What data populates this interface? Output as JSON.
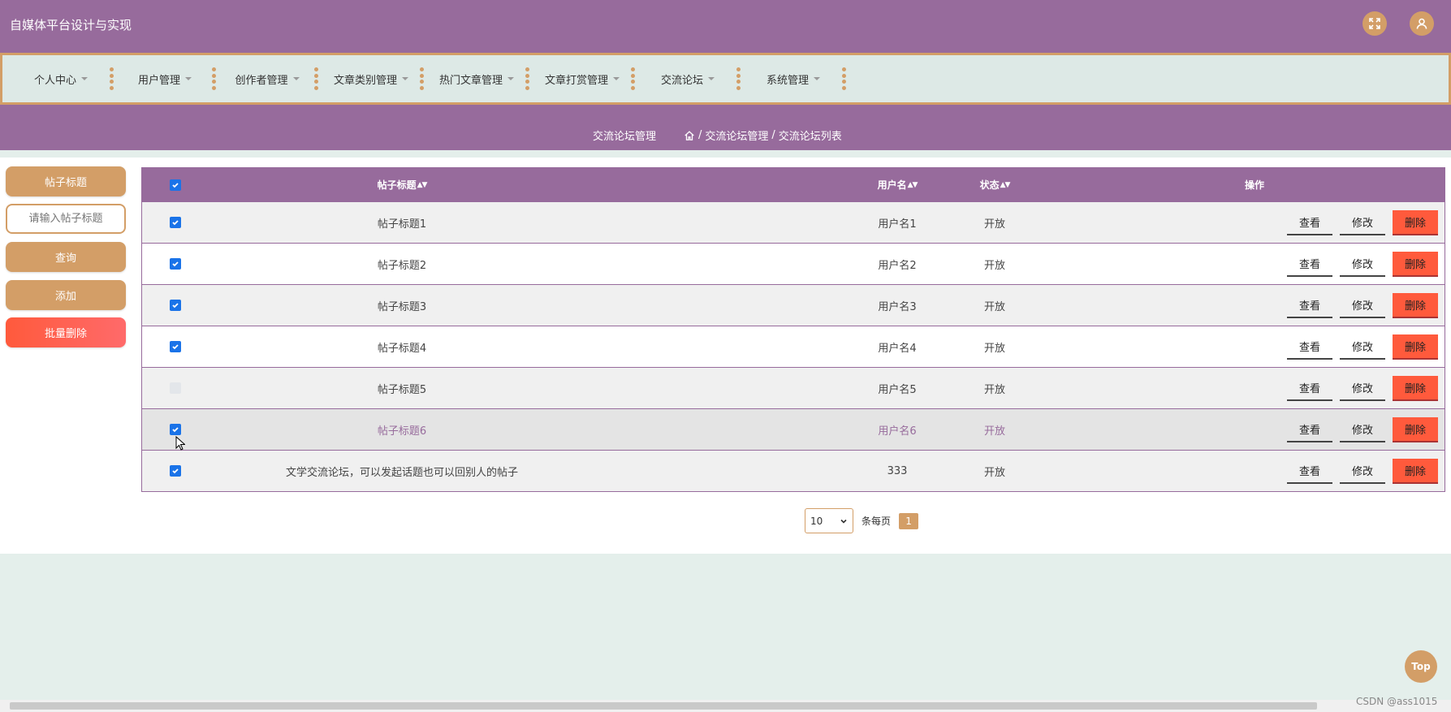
{
  "header": {
    "title": "自媒体平台设计与实现"
  },
  "nav": {
    "items": [
      {
        "label": "个人中心"
      },
      {
        "label": "用户管理"
      },
      {
        "label": "创作者管理"
      },
      {
        "label": "文章类别管理"
      },
      {
        "label": "热门文章管理"
      },
      {
        "label": "文章打赏管理"
      },
      {
        "label": "交流论坛"
      },
      {
        "label": "系统管理"
      }
    ]
  },
  "breadcrumb": {
    "section": "交流论坛管理",
    "path1": "交流论坛管理",
    "sep": "/",
    "path2": "交流论坛列表"
  },
  "sidebar": {
    "title_button": "帖子标题",
    "search_placeholder": "请输入帖子标题",
    "query_button": "查询",
    "add_button": "添加",
    "batch_delete_button": "批量删除"
  },
  "table": {
    "columns": {
      "title": "帖子标题",
      "user": "用户名",
      "status": "状态",
      "ops": "操作"
    },
    "rows": [
      {
        "checked": true,
        "title": "帖子标题1",
        "user": "用户名1",
        "status": "开放"
      },
      {
        "checked": true,
        "title": "帖子标题2",
        "user": "用户名2",
        "status": "开放"
      },
      {
        "checked": true,
        "title": "帖子标题3",
        "user": "用户名3",
        "status": "开放"
      },
      {
        "checked": true,
        "title": "帖子标题4",
        "user": "用户名4",
        "status": "开放"
      },
      {
        "checked": false,
        "title": "帖子标题5",
        "user": "用户名5",
        "status": "开放"
      },
      {
        "checked": true,
        "title": "帖子标题6",
        "user": "用户名6",
        "status": "开放"
      },
      {
        "checked": true,
        "title": "文学交流论坛，可以发起话题也可以回别人的帖子",
        "user": "333",
        "status": "开放"
      }
    ],
    "op_view": "查看",
    "op_edit": "修改",
    "op_delete": "删除"
  },
  "pager": {
    "page_size": "10",
    "per_page_label": "条每页",
    "current_page": "1"
  },
  "top_button": "Top",
  "watermark": "CSDN @ass1015",
  "colors": {
    "primary": "#976b9c",
    "accent": "#d39e67",
    "danger": "#ff5a3c"
  }
}
